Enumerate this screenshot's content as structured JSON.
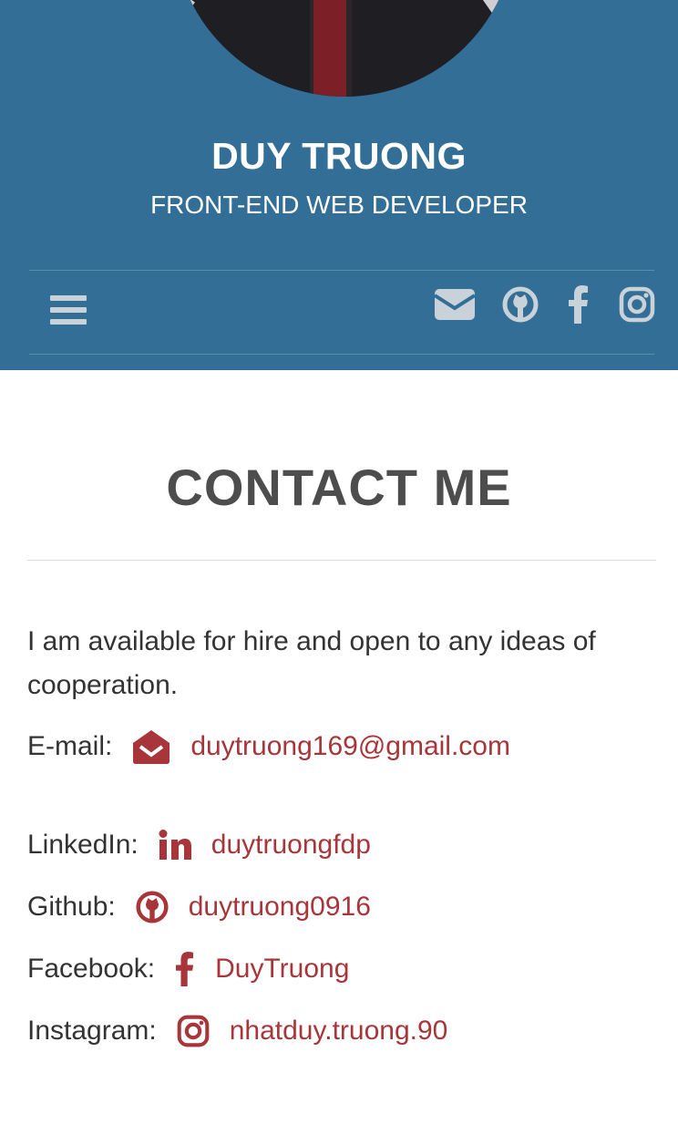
{
  "header": {
    "name": "DUY TRUONG",
    "role": "FRONT-END WEB DEVELOPER",
    "background_color": "#326e96"
  },
  "nav": {
    "menu_icon": "hamburger-menu-icon",
    "social_icons": [
      "envelope-icon",
      "github-icon",
      "facebook-icon",
      "instagram-icon"
    ]
  },
  "contact": {
    "title": "CONTACT ME",
    "intro": "I am available for hire and open to any ideas of cooperation.",
    "accent_color": "#a7353a",
    "items": [
      {
        "label": "E-mail:",
        "icon": "envelope-open-icon",
        "value": "duytruong169@gmail.com"
      },
      {
        "label": "LinkedIn:",
        "icon": "linkedin-icon",
        "value": "duytruongfdp"
      },
      {
        "label": "Github:",
        "icon": "github-icon",
        "value": "duytruong0916"
      },
      {
        "label": "Facebook:",
        "icon": "facebook-icon",
        "value": "DuyTruong"
      },
      {
        "label": "Instagram:",
        "icon": "instagram-icon",
        "value": "nhatduy.truong.90"
      }
    ]
  }
}
